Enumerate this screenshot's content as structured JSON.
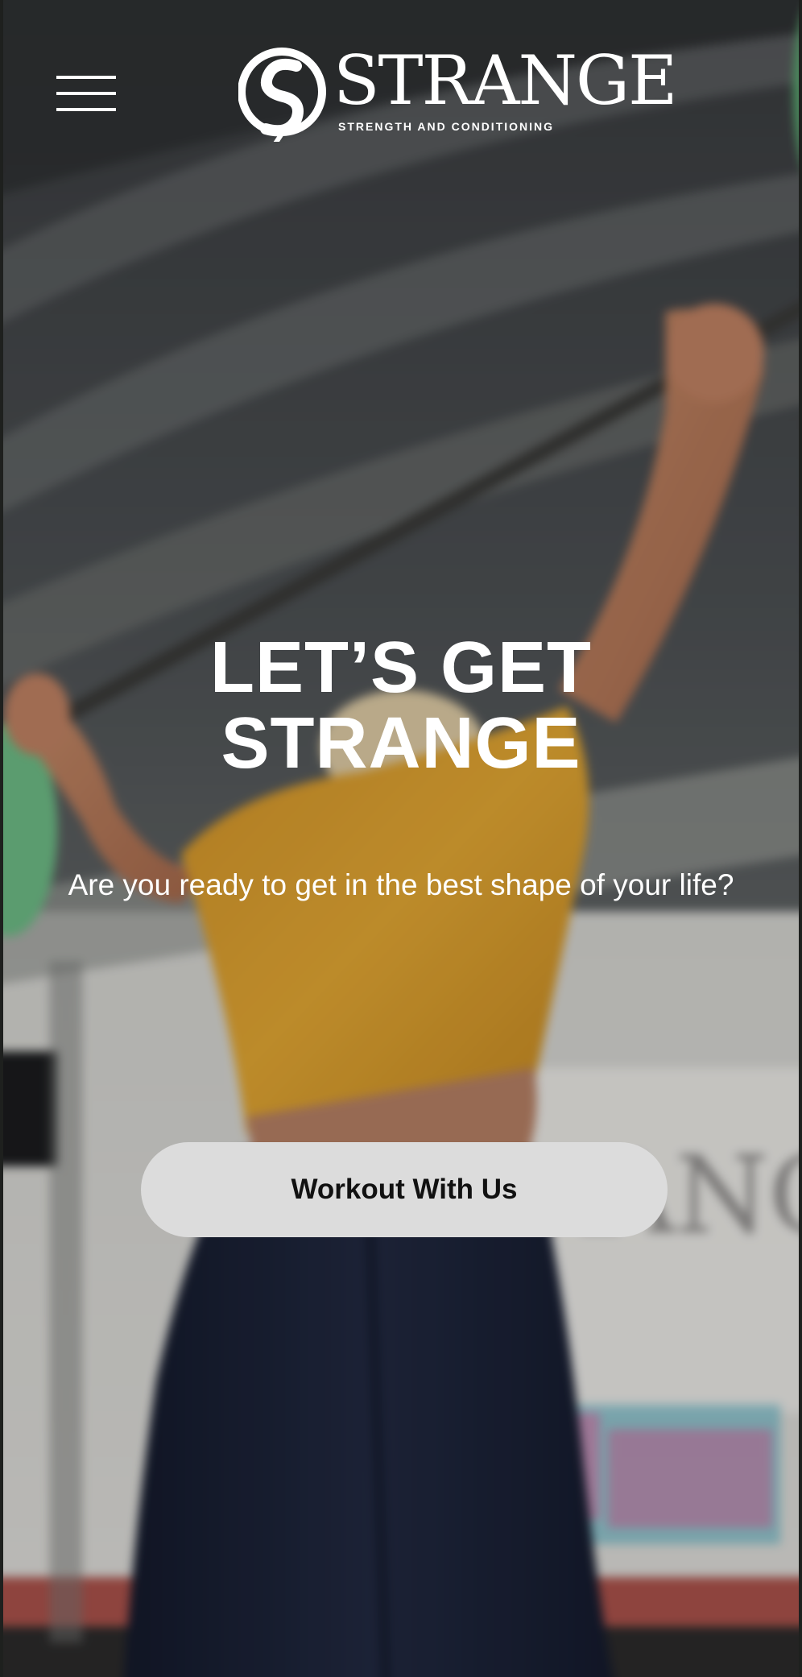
{
  "header": {
    "menu_icon": "hamburger-menu-icon",
    "logo": {
      "word": "STRANGE",
      "tagline": "STRENGTH AND CONDITIONING",
      "mark_icon": "strange-s-monogram-icon"
    }
  },
  "hero": {
    "headline": "LET’S GET STRANGE",
    "subheadline": "Are you ready to get in the best shape of your life?",
    "cta_label": "Workout With Us",
    "background": "blurred photo of athlete lifting barbell overhead in gym"
  },
  "colors": {
    "text": "#ffffff",
    "button_bg": "#dcdcdc",
    "button_text": "#111111",
    "shirt_yellow": "#e0a430",
    "leggings_navy": "#1c2236"
  }
}
